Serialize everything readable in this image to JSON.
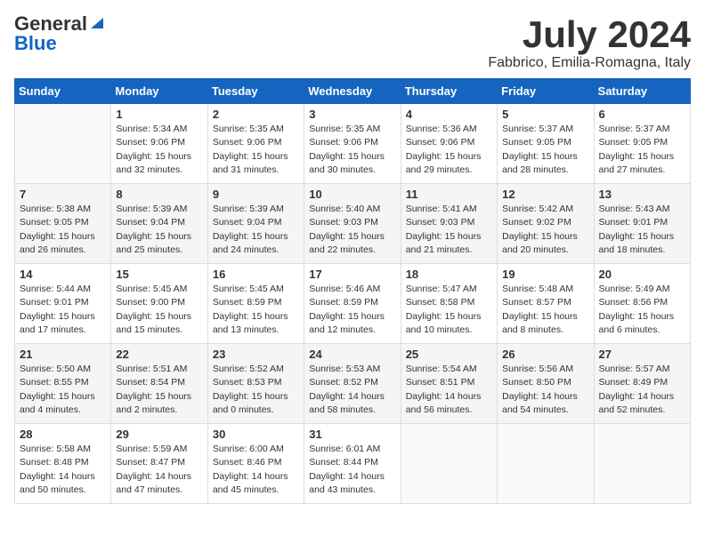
{
  "header": {
    "logo_general": "General",
    "logo_blue": "Blue",
    "month": "July 2024",
    "location": "Fabbrico, Emilia-Romagna, Italy"
  },
  "weekdays": [
    "Sunday",
    "Monday",
    "Tuesday",
    "Wednesday",
    "Thursday",
    "Friday",
    "Saturday"
  ],
  "weeks": [
    [
      {
        "day": "",
        "content": ""
      },
      {
        "day": "1",
        "content": "Sunrise: 5:34 AM\nSunset: 9:06 PM\nDaylight: 15 hours\nand 32 minutes."
      },
      {
        "day": "2",
        "content": "Sunrise: 5:35 AM\nSunset: 9:06 PM\nDaylight: 15 hours\nand 31 minutes."
      },
      {
        "day": "3",
        "content": "Sunrise: 5:35 AM\nSunset: 9:06 PM\nDaylight: 15 hours\nand 30 minutes."
      },
      {
        "day": "4",
        "content": "Sunrise: 5:36 AM\nSunset: 9:06 PM\nDaylight: 15 hours\nand 29 minutes."
      },
      {
        "day": "5",
        "content": "Sunrise: 5:37 AM\nSunset: 9:05 PM\nDaylight: 15 hours\nand 28 minutes."
      },
      {
        "day": "6",
        "content": "Sunrise: 5:37 AM\nSunset: 9:05 PM\nDaylight: 15 hours\nand 27 minutes."
      }
    ],
    [
      {
        "day": "7",
        "content": "Sunrise: 5:38 AM\nSunset: 9:05 PM\nDaylight: 15 hours\nand 26 minutes."
      },
      {
        "day": "8",
        "content": "Sunrise: 5:39 AM\nSunset: 9:04 PM\nDaylight: 15 hours\nand 25 minutes."
      },
      {
        "day": "9",
        "content": "Sunrise: 5:39 AM\nSunset: 9:04 PM\nDaylight: 15 hours\nand 24 minutes."
      },
      {
        "day": "10",
        "content": "Sunrise: 5:40 AM\nSunset: 9:03 PM\nDaylight: 15 hours\nand 22 minutes."
      },
      {
        "day": "11",
        "content": "Sunrise: 5:41 AM\nSunset: 9:03 PM\nDaylight: 15 hours\nand 21 minutes."
      },
      {
        "day": "12",
        "content": "Sunrise: 5:42 AM\nSunset: 9:02 PM\nDaylight: 15 hours\nand 20 minutes."
      },
      {
        "day": "13",
        "content": "Sunrise: 5:43 AM\nSunset: 9:01 PM\nDaylight: 15 hours\nand 18 minutes."
      }
    ],
    [
      {
        "day": "14",
        "content": "Sunrise: 5:44 AM\nSunset: 9:01 PM\nDaylight: 15 hours\nand 17 minutes."
      },
      {
        "day": "15",
        "content": "Sunrise: 5:45 AM\nSunset: 9:00 PM\nDaylight: 15 hours\nand 15 minutes."
      },
      {
        "day": "16",
        "content": "Sunrise: 5:45 AM\nSunset: 8:59 PM\nDaylight: 15 hours\nand 13 minutes."
      },
      {
        "day": "17",
        "content": "Sunrise: 5:46 AM\nSunset: 8:59 PM\nDaylight: 15 hours\nand 12 minutes."
      },
      {
        "day": "18",
        "content": "Sunrise: 5:47 AM\nSunset: 8:58 PM\nDaylight: 15 hours\nand 10 minutes."
      },
      {
        "day": "19",
        "content": "Sunrise: 5:48 AM\nSunset: 8:57 PM\nDaylight: 15 hours\nand 8 minutes."
      },
      {
        "day": "20",
        "content": "Sunrise: 5:49 AM\nSunset: 8:56 PM\nDaylight: 15 hours\nand 6 minutes."
      }
    ],
    [
      {
        "day": "21",
        "content": "Sunrise: 5:50 AM\nSunset: 8:55 PM\nDaylight: 15 hours\nand 4 minutes."
      },
      {
        "day": "22",
        "content": "Sunrise: 5:51 AM\nSunset: 8:54 PM\nDaylight: 15 hours\nand 2 minutes."
      },
      {
        "day": "23",
        "content": "Sunrise: 5:52 AM\nSunset: 8:53 PM\nDaylight: 15 hours\nand 0 minutes."
      },
      {
        "day": "24",
        "content": "Sunrise: 5:53 AM\nSunset: 8:52 PM\nDaylight: 14 hours\nand 58 minutes."
      },
      {
        "day": "25",
        "content": "Sunrise: 5:54 AM\nSunset: 8:51 PM\nDaylight: 14 hours\nand 56 minutes."
      },
      {
        "day": "26",
        "content": "Sunrise: 5:56 AM\nSunset: 8:50 PM\nDaylight: 14 hours\nand 54 minutes."
      },
      {
        "day": "27",
        "content": "Sunrise: 5:57 AM\nSunset: 8:49 PM\nDaylight: 14 hours\nand 52 minutes."
      }
    ],
    [
      {
        "day": "28",
        "content": "Sunrise: 5:58 AM\nSunset: 8:48 PM\nDaylight: 14 hours\nand 50 minutes."
      },
      {
        "day": "29",
        "content": "Sunrise: 5:59 AM\nSunset: 8:47 PM\nDaylight: 14 hours\nand 47 minutes."
      },
      {
        "day": "30",
        "content": "Sunrise: 6:00 AM\nSunset: 8:46 PM\nDaylight: 14 hours\nand 45 minutes."
      },
      {
        "day": "31",
        "content": "Sunrise: 6:01 AM\nSunset: 8:44 PM\nDaylight: 14 hours\nand 43 minutes."
      },
      {
        "day": "",
        "content": ""
      },
      {
        "day": "",
        "content": ""
      },
      {
        "day": "",
        "content": ""
      }
    ]
  ]
}
